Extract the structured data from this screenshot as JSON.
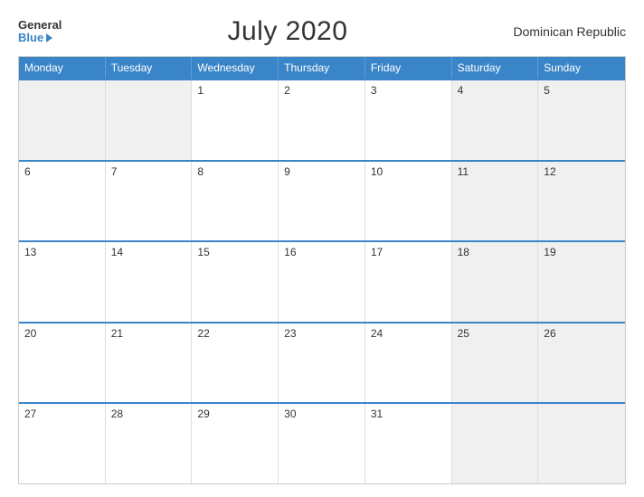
{
  "logo": {
    "general": "General",
    "blue": "Blue"
  },
  "title": "July 2020",
  "country": "Dominican Republic",
  "days": [
    "Monday",
    "Tuesday",
    "Wednesday",
    "Thursday",
    "Friday",
    "Saturday",
    "Sunday"
  ],
  "weeks": [
    [
      "",
      "",
      "1",
      "2",
      "3",
      "4",
      "5"
    ],
    [
      "6",
      "7",
      "8",
      "9",
      "10",
      "11",
      "12"
    ],
    [
      "13",
      "14",
      "15",
      "16",
      "17",
      "18",
      "19"
    ],
    [
      "20",
      "21",
      "22",
      "23",
      "24",
      "25",
      "26"
    ],
    [
      "27",
      "28",
      "29",
      "30",
      "31",
      "",
      ""
    ]
  ]
}
